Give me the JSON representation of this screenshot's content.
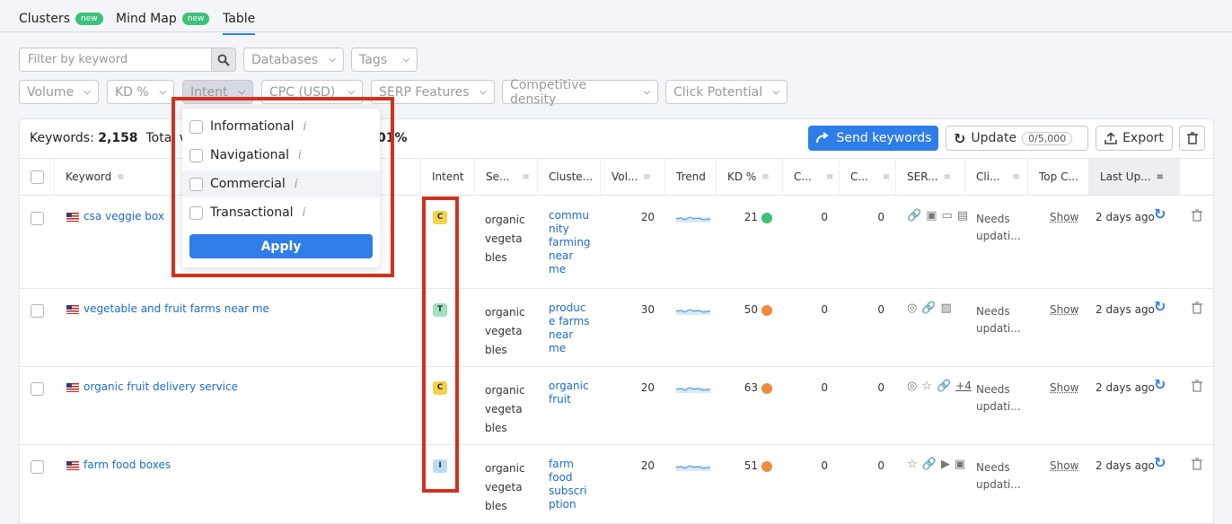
{
  "tabs": [
    {
      "label": "Clusters",
      "badge": "new"
    },
    {
      "label": "Mind Map",
      "badge": "new"
    },
    {
      "label": "Table",
      "badge": ""
    }
  ],
  "filters": {
    "search_placeholder": "Filter by keyword",
    "databases": "Databases",
    "tags": "Tags",
    "volume": "Volume",
    "kd": "KD %",
    "intent": "Intent",
    "cpc": "CPC (USD)",
    "serp": "SERP Features",
    "competitive": "Competitive density",
    "click_potential": "Click Potential"
  },
  "summary": {
    "keywords_label": "Keywords:",
    "keywords_count": "2,158",
    "total_label": "Total vo",
    "pct": "01%"
  },
  "actions": {
    "send": "Send keywords",
    "update": "Update",
    "quota": "0/5,000",
    "export": "Export"
  },
  "columns": [
    "Keyword",
    "Intent",
    "Se...",
    "Cluste...",
    "Vol...",
    "Trend",
    "KD %",
    "C...",
    "C...",
    "SER...",
    "Cli...",
    "Top C...",
    "Last Up..."
  ],
  "intent_menu": {
    "options": [
      "Informational",
      "Navigational",
      "Commercial",
      "Transactional"
    ],
    "info": "i",
    "apply": "Apply"
  },
  "rows": [
    {
      "keyword": "csa veggie box",
      "intent": "C",
      "intent_color": "#f5d24b",
      "seed": [
        "organic",
        "vegeta",
        "bles"
      ],
      "cluster": [
        "commu",
        "nity",
        "farming",
        "near",
        "me"
      ],
      "volume": "20",
      "kd": "21",
      "kd_color": "#3ec07a",
      "c1": "0",
      "c2": "0",
      "serp_icons": [
        "link-icon",
        "image-icon",
        "comment-icon",
        "news-icon"
      ],
      "serp_extra": "",
      "click": [
        "Needs",
        "updati..."
      ],
      "top": "Show",
      "updated": "2 days ago"
    },
    {
      "keyword": "vegetable and fruit farms near me",
      "intent": "T",
      "intent_color": "#9ee2c0",
      "seed": [
        "organic",
        "vegeta",
        "bles"
      ],
      "cluster": [
        "produc",
        "e farms",
        "near",
        "me"
      ],
      "volume": "30",
      "kd": "50",
      "kd_color": "#f08a3c",
      "c1": "0",
      "c2": "0",
      "serp_icons": [
        "pin-icon",
        "link-icon",
        "image-stack-icon"
      ],
      "serp_extra": "",
      "click": [
        "Needs",
        "updati..."
      ],
      "top": "Show",
      "updated": "2 days ago"
    },
    {
      "keyword": "organic fruit delivery service",
      "intent": "C",
      "intent_color": "#f5d24b",
      "seed": [
        "organic",
        "vegeta",
        "bles"
      ],
      "cluster": [
        "organic",
        "fruit"
      ],
      "volume": "20",
      "kd": "63",
      "kd_color": "#f08a3c",
      "c1": "0",
      "c2": "0",
      "serp_icons": [
        "pin-icon",
        "star-icon",
        "link-icon"
      ],
      "serp_extra": "+4",
      "click": [
        "Needs",
        "updati..."
      ],
      "top": "Show",
      "updated": "2 days ago"
    },
    {
      "keyword": "farm food boxes",
      "intent": "I",
      "intent_color": "#b9dcf5",
      "seed": [
        "organic",
        "vegeta",
        "bles"
      ],
      "cluster": [
        "farm",
        "food",
        "subscri",
        "ption"
      ],
      "volume": "20",
      "kd": "51",
      "kd_color": "#f08a3c",
      "c1": "0",
      "c2": "0",
      "serp_icons": [
        "star-icon",
        "link-icon",
        "video-icon",
        "image-icon"
      ],
      "serp_extra": "",
      "click": [
        "Needs",
        "updati..."
      ],
      "top": "Show",
      "updated": "2 days ago"
    }
  ]
}
